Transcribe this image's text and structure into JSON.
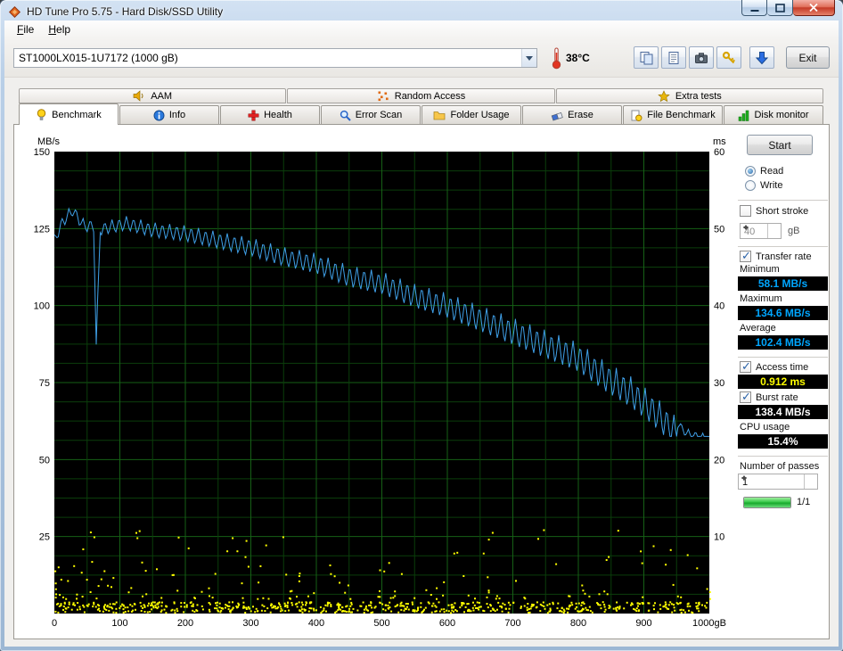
{
  "window": {
    "title": "HD Tune Pro 5.75 - Hard Disk/SSD Utility"
  },
  "menu": {
    "items": [
      "File",
      "Help"
    ]
  },
  "toolbar": {
    "drive_selector": "ST1000LX015-1U7172 (1000 gB)",
    "temperature": "38°C",
    "exit_label": "Exit",
    "button_icons": [
      "copy-pages",
      "copy-report",
      "camera",
      "key",
      "save-arrow"
    ]
  },
  "icons": {
    "app": "orange-diamond-gem",
    "temperature": "thermometer",
    "tabs_top": [
      "speaker",
      "scatter-dots",
      "gold-star"
    ],
    "tabs_main": [
      "yellow-lamp",
      "info-circle",
      "red-cross",
      "magnifier",
      "folder",
      "eraser",
      "page-gauge",
      "green-bars"
    ]
  },
  "tabs": {
    "top": [
      "AAM",
      "Random Access",
      "Extra tests"
    ],
    "main": [
      "Benchmark",
      "Info",
      "Health",
      "Error Scan",
      "Folder Usage",
      "Erase",
      "File Benchmark",
      "Disk monitor"
    ],
    "active": "Benchmark"
  },
  "controls": {
    "start_button": "Start",
    "read_label": "Read",
    "write_label": "Write",
    "short_stroke_label": "Short stroke",
    "short_stroke_value": "40",
    "short_stroke_unit": "gB",
    "transfer_rate_label": "Transfer rate",
    "minimum_label": "Minimum",
    "minimum_value": "58.1 MB/s",
    "maximum_label": "Maximum",
    "maximum_value": "134.6 MB/s",
    "average_label": "Average",
    "average_value": "102.4 MB/s",
    "access_time_label": "Access time",
    "access_time_value": "0.912 ms",
    "burst_rate_label": "Burst rate",
    "burst_rate_value": "138.4 MB/s",
    "cpu_usage_label": "CPU usage",
    "cpu_usage_value": "15.4%",
    "passes_label": "Number of passes",
    "passes_value": "1",
    "progress_label": "1/1"
  },
  "chart_data": {
    "type": "line",
    "title": "Read benchmark: transfer rate line with access-time scatter",
    "x_axis": {
      "min": 0,
      "max": 1000,
      "unit": "gB",
      "ticks": [
        0,
        100,
        200,
        300,
        400,
        500,
        600,
        700,
        800,
        900,
        1000
      ],
      "tick_step": 100,
      "grid_step": 50
    },
    "y_left": {
      "label": "MB/s",
      "min": 0,
      "max": 150,
      "ticks": [
        150,
        125,
        100,
        75,
        50,
        25
      ],
      "tick_step": 25,
      "grid_step": 6.25
    },
    "y_right": {
      "label": "ms",
      "min": 0,
      "max": 60,
      "ticks": [
        60,
        50,
        40,
        30,
        20,
        10
      ],
      "tick_step": 10
    },
    "colors": {
      "plot_bg": "#000000",
      "grid_major": "#166016",
      "grid_minor": "#0b3e0b",
      "transfer_line": "#3fa0e8",
      "access_dots": "#ffff00"
    },
    "series": [
      {
        "name": "Transfer rate",
        "unit": "MB/s",
        "axis": "left",
        "color": "#3fa0e8",
        "min": 58.1,
        "max": 134.6,
        "avg": 102.4,
        "envelope": [
          [
            0,
            123
          ],
          [
            12,
            129
          ],
          [
            28,
            133
          ],
          [
            45,
            128
          ],
          [
            60,
            128
          ],
          [
            64,
            89
          ],
          [
            70,
            127
          ],
          [
            110,
            129
          ],
          [
            150,
            127
          ],
          [
            200,
            126
          ],
          [
            250,
            124
          ],
          [
            300,
            122
          ],
          [
            350,
            119
          ],
          [
            400,
            117
          ],
          [
            450,
            113
          ],
          [
            500,
            111
          ],
          [
            550,
            107
          ],
          [
            600,
            104
          ],
          [
            650,
            100
          ],
          [
            700,
            96
          ],
          [
            750,
            92
          ],
          [
            800,
            88
          ],
          [
            840,
            82
          ],
          [
            880,
            77
          ],
          [
            910,
            72
          ],
          [
            940,
            66
          ],
          [
            965,
            60
          ],
          [
            1000,
            58
          ]
        ],
        "oscillation": {
          "period_gb": 11,
          "amp_start": 4,
          "amp_end": 11
        }
      },
      {
        "name": "Access time",
        "unit": "ms",
        "axis": "right",
        "color": "#ffff00",
        "avg": 0.912,
        "band": {
          "count": 620,
          "y_min": 0.2,
          "y_max": 1.6
        },
        "scatter": {
          "count": 150,
          "y_min": 2.0,
          "y_max": 11.0
        },
        "seed": 20240601
      }
    ]
  }
}
